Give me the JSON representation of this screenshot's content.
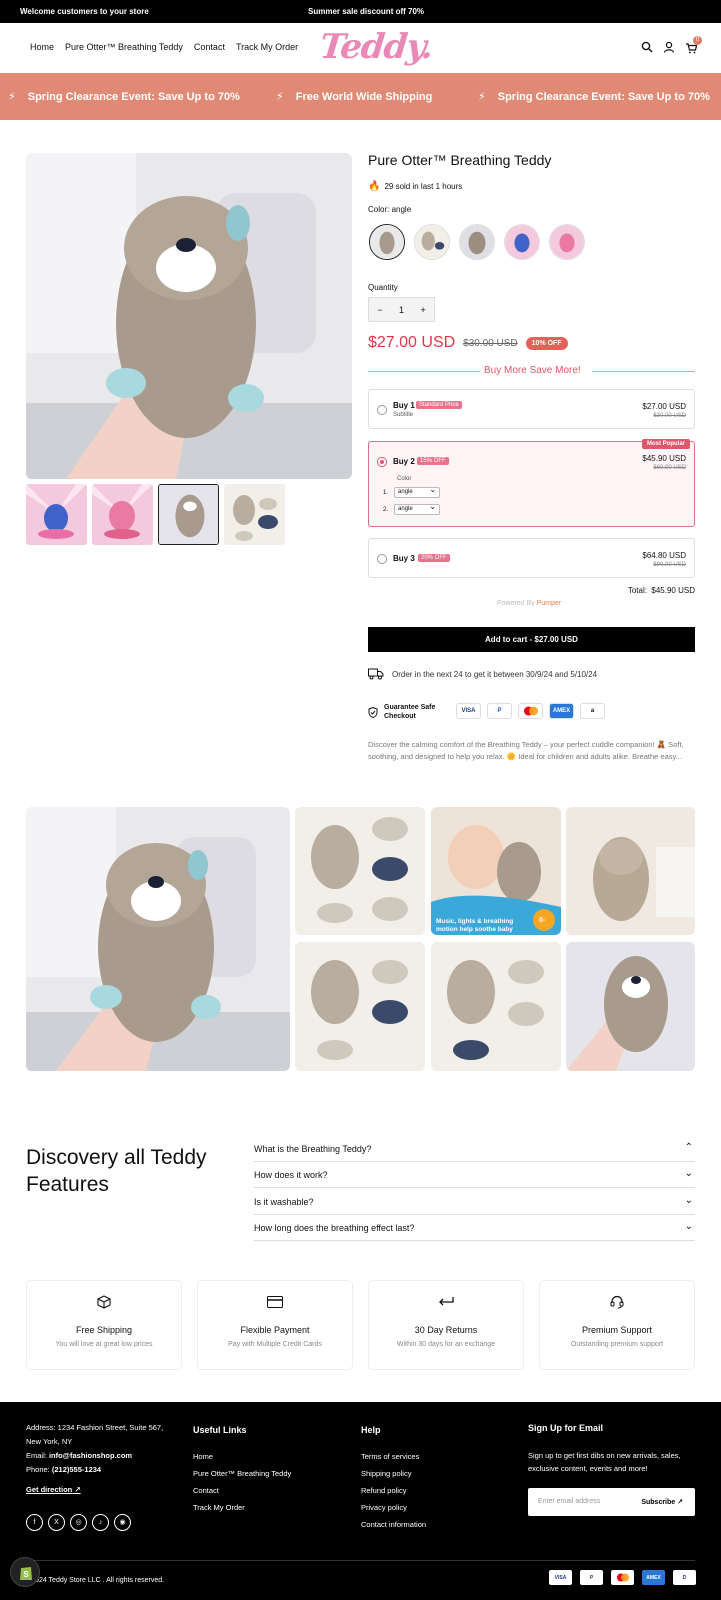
{
  "topbar": {
    "left": "Welcome customers to your store",
    "center": "Summer sale discount off 70%"
  },
  "header": {
    "nav": [
      "Home",
      "Pure Otter™ Breathing Teddy",
      "Contact",
      "Track My Order"
    ],
    "logo": "Teddy.",
    "cart_count": "0",
    "icons": [
      "search-icon",
      "user-icon",
      "cart-icon"
    ]
  },
  "promo": {
    "items": [
      "Spring Clearance Event: Save Up to 70%",
      "Free World Wide Shipping",
      "Spring Clearance Event: Save Up to 70%"
    ]
  },
  "product": {
    "title": "Pure Otter™ Breathing Teddy",
    "sold": "29 sold in last 1 hours",
    "color_label": "Color: angle",
    "quantity_label": "Quantity",
    "quantity": "1",
    "minus": "−",
    "plus": "+",
    "price": "$27.00 USD",
    "compare_price": "$30.00 USD",
    "off_badge": "10% OFF",
    "bundle_header": "Buy More Save More!",
    "options": [
      {
        "label": "Buy 1",
        "tag": "Standard Price",
        "sub": "Subtitle",
        "price": "$27.00 USD",
        "old": "$30.00 USD"
      },
      {
        "label": "Buy 2",
        "tag": "15% OFF",
        "sub": "Color",
        "price": "$45.90 USD",
        "old": "$60.00 USD",
        "badge": "Most Popular",
        "rows": [
          {
            "n": "1.",
            "v": "angle"
          },
          {
            "n": "2.",
            "v": "angle"
          }
        ]
      },
      {
        "label": "Buy 3",
        "tag": "20% OFF",
        "price": "$64.80 USD",
        "old": "$90.00 USD"
      }
    ],
    "total_label": "Total:",
    "total_value": "$45.90 USD",
    "powered_by": "Powered By",
    "powered_brand": "Pumper",
    "add_to_cart": "Add to cart - $27.00 USD",
    "order_text": "Order in the next 24 to get it between 30/9/24 and 5/10/24",
    "guarantee": "Guarantee Safe Checkout",
    "payments": [
      "VISA",
      "P",
      "MC",
      "AMEX",
      "a"
    ],
    "description": "Discover the calming comfort of the Breathing Teddy – your perfect cuddle companion! 🧸 Soft, soothing, and designed to help you relax. 🌼 Ideal for children and adults alike. Breathe easy..."
  },
  "gallery": {
    "overlay_text": "Music, lights & breathing motion help soothe baby",
    "overlay_badge": "0-"
  },
  "features": {
    "title": "Discovery all Teddy Features",
    "faqs": [
      {
        "q": "What is the Breathing Teddy?",
        "icon": "chevron-up-icon"
      },
      {
        "q": "How does it work?",
        "icon": "chevron-down-icon"
      },
      {
        "q": "Is it washable?",
        "icon": "chevron-down-icon"
      },
      {
        "q": "How long does the breathing effect last?",
        "icon": "chevron-down-icon"
      }
    ]
  },
  "cards": [
    {
      "title": "Free Shipping",
      "sub": "You will love at great low prices",
      "icon": "box-icon"
    },
    {
      "title": "Flexible Payment",
      "sub": "Pay with Multiple Credit Cards",
      "icon": "card-icon"
    },
    {
      "title": "30 Day Returns",
      "sub": "Within 30 days for an exchange",
      "icon": "return-icon"
    },
    {
      "title": "Premium Support",
      "sub": "Outstanding premium support",
      "icon": "headset-icon"
    }
  ],
  "footer": {
    "address": "Address: 1234 Fashion Street, Suite 567, New York, NY",
    "email_label": "Email:",
    "email": "info@fashionshop.com",
    "phone_label": "Phone:",
    "phone": "(212)555-1234",
    "directions": "Get direction",
    "useful_title": "Useful Links",
    "useful_links": [
      "Home",
      "Pure Otter™ Breathing Teddy",
      "Contact",
      "Track My Order"
    ],
    "help_title": "Help",
    "help_links": [
      "Terms of services",
      "Shipping policy",
      "Refund policy",
      "Privacy policy",
      "Contact information"
    ],
    "signup_title": "Sign Up for Email",
    "signup_text": "Sign up to get first dibs on new arrivals, sales, exclusive content, events and more!",
    "email_placeholder": "Enter email address",
    "subscribe": "Subscribe",
    "copyright": "©2024 Teddy Store LLC . All rights reserved.",
    "social": [
      "f",
      "X",
      "◎",
      "♪",
      "◉"
    ],
    "payments": [
      "VISA",
      "P",
      "MC",
      "AMEX",
      "D"
    ]
  },
  "colors": {
    "promo_bg": "#e08a75",
    "accent_red": "#e0364a",
    "pink": "#e0566b",
    "logo_pink": "#e889b6"
  }
}
